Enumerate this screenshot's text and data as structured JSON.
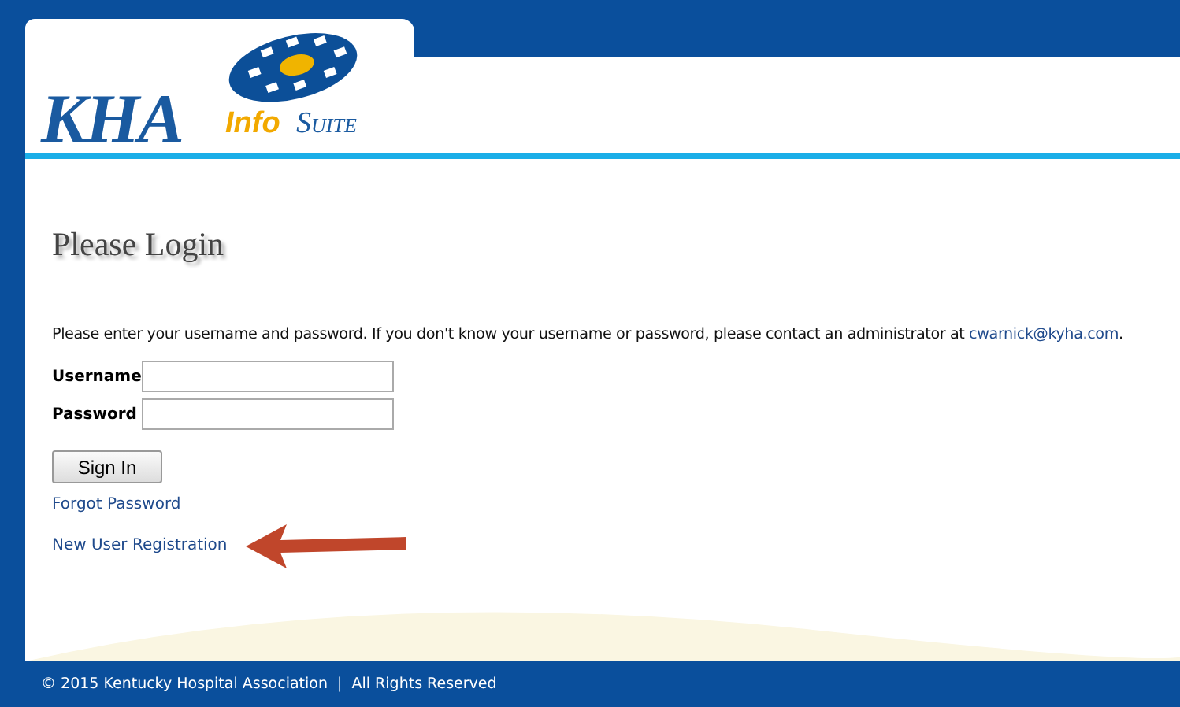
{
  "logo": {
    "brand": "KHA",
    "product_first": "Info",
    "product_second": "Suite"
  },
  "heading": "Please Login",
  "instructions": {
    "text": "Please enter your username and password. If you don't know your username or password, please contact an administrator at ",
    "email": "cwarnick@kyha.com",
    "end": "."
  },
  "fields": [
    {
      "label": "Username"
    },
    {
      "label": "Password"
    }
  ],
  "sign_in_button": "Sign In",
  "links": [
    {
      "label": "Forgot Password",
      "highlighted": false
    },
    {
      "label": "New User Registration",
      "highlighted": true
    }
  ],
  "footer": "© 2015 Kentucky Hospital Association  |  All Rights Reserved"
}
